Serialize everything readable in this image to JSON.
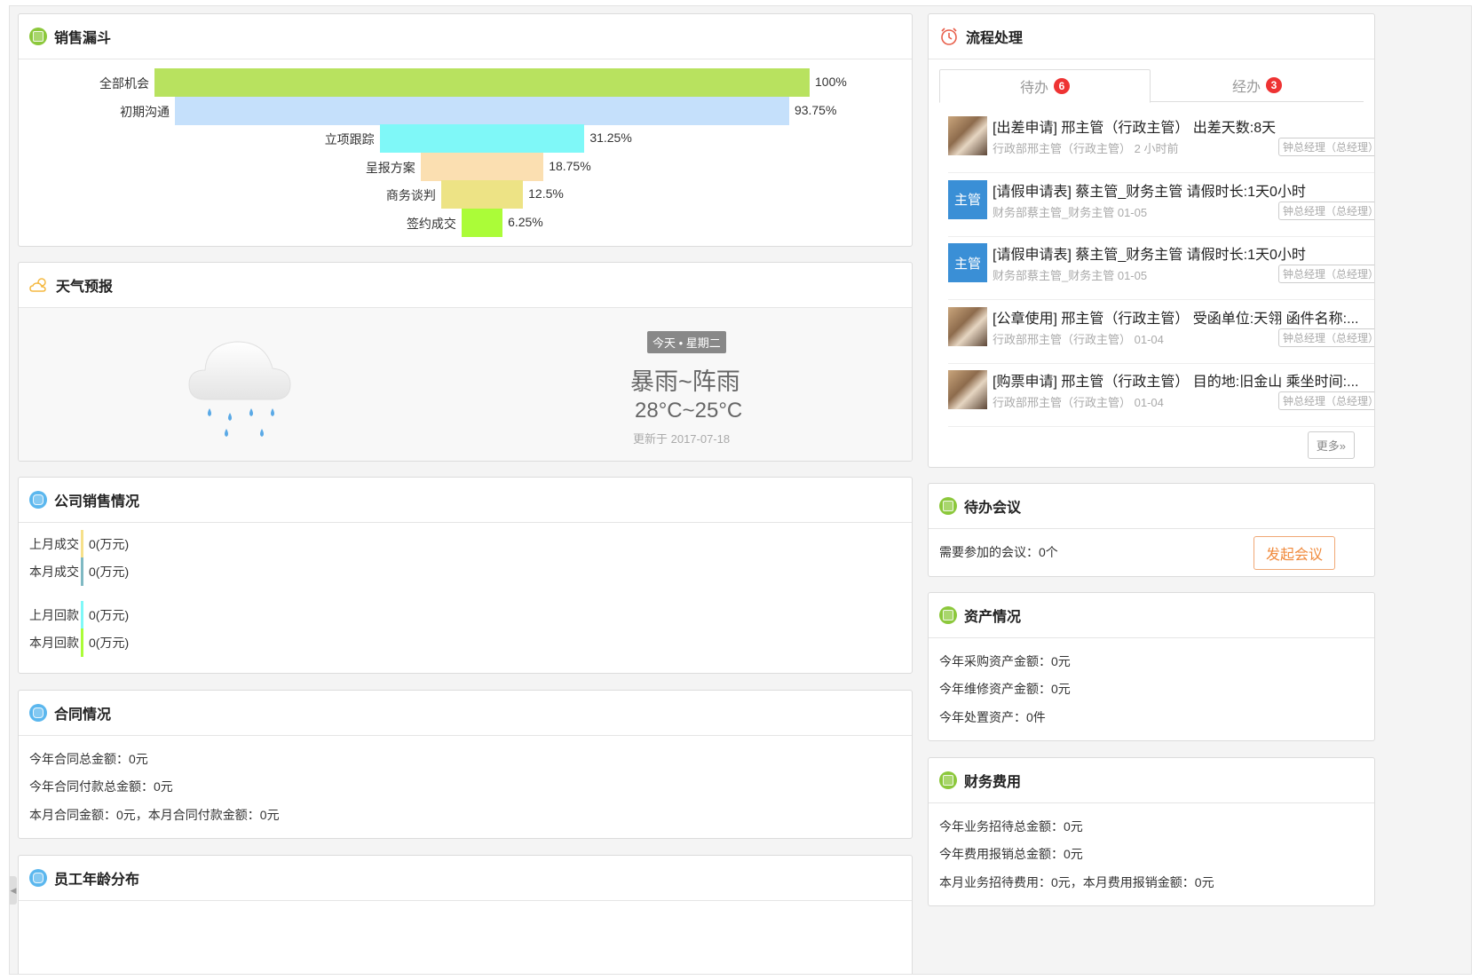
{
  "sales_funnel": {
    "title": "销售漏斗",
    "stages": [
      {
        "label": "全部机会",
        "value": "100%",
        "color": "#b8e25f"
      },
      {
        "label": "初期沟通",
        "value": "93.75%",
        "color": "#c5e0fb"
      },
      {
        "label": "立项跟踪",
        "value": "31.25%",
        "color": "#7ff8f8"
      },
      {
        "label": "呈报方案",
        "value": "18.75%",
        "color": "#fbdfb1"
      },
      {
        "label": "商务谈判",
        "value": "12.5%",
        "color": "#ede385"
      },
      {
        "label": "签约成交",
        "value": "6.25%",
        "color": "#abfc38"
      }
    ]
  },
  "weather": {
    "title": "天气预报",
    "today_label": "今天 • 星期二",
    "description": "暴雨~阵雨",
    "temperature": "28°C~25°C",
    "updated": "更新于 2017-07-18",
    "icon": "rain-cloud-icon"
  },
  "company_sales": {
    "title": "公司销售情况",
    "rows": [
      {
        "label": "上月成交",
        "value": "0(万元)",
        "color": "#f6e08a"
      },
      {
        "label": "本月成交",
        "value": "0(万元)",
        "color": "#7fb9c3"
      },
      {
        "label": "上月回款",
        "value": "0(万元)",
        "color": "#7ff8f8"
      },
      {
        "label": "本月回款",
        "value": "0(万元)",
        "color": "#abfc38"
      }
    ]
  },
  "contracts": {
    "title": "合同情况",
    "lines": [
      "今年合同总金额：0元",
      "今年合同付款总金额：0元",
      "本月合同金额：0元，本月合同付款金额：0元"
    ]
  },
  "employee_age": {
    "title": "员工年龄分布"
  },
  "workflow": {
    "title": "流程处理",
    "tabs": [
      {
        "label": "待办",
        "count": "6"
      },
      {
        "label": "经办",
        "count": "3"
      }
    ],
    "tasks": [
      {
        "avatar": "photo",
        "avatar_text": "",
        "title": "[出差申请] 邢主管（行政主管） 出差天数:8天",
        "meta": "行政部邢主管（行政主管） 2 小时前",
        "tag": "钟总经理（总经理）"
      },
      {
        "avatar": "text",
        "avatar_text": "主管",
        "title": "[请假申请表] 蔡主管_财务主管 请假时长:1天0小时",
        "meta": "财务部蔡主管_财务主管 01-05",
        "tag": "钟总经理（总经理）"
      },
      {
        "avatar": "text",
        "avatar_text": "主管",
        "title": "[请假申请表] 蔡主管_财务主管 请假时长:1天0小时",
        "meta": "财务部蔡主管_财务主管 01-05",
        "tag": "钟总经理（总经理）"
      },
      {
        "avatar": "photo",
        "avatar_text": "",
        "title": "[公章使用] 邢主管（行政主管） 受函单位:天翎 函件名称:...",
        "meta": "行政部邢主管（行政主管） 01-04",
        "tag": "钟总经理（总经理）"
      },
      {
        "avatar": "photo",
        "avatar_text": "",
        "title": "[购票申请] 邢主管（行政主管） 目的地:旧金山 乘坐时间:...",
        "meta": "行政部邢主管（行政主管） 01-04",
        "tag": "钟总经理（总经理）"
      }
    ],
    "more_label": "更多»"
  },
  "meetings": {
    "title": "待办会议",
    "text": "需要参加的会议：0个",
    "button": "发起会议"
  },
  "assets": {
    "title": "资产情况",
    "lines": [
      "今年采购资产金额：0元",
      "今年维修资产金额：0元",
      "今年处置资产：0件"
    ]
  },
  "finance": {
    "title": "财务费用",
    "lines": [
      "今年业务招待总金额：0元",
      "今年费用报销总金额：0元",
      "本月业务招待费用：0元，本月费用报销金额：0元"
    ]
  }
}
